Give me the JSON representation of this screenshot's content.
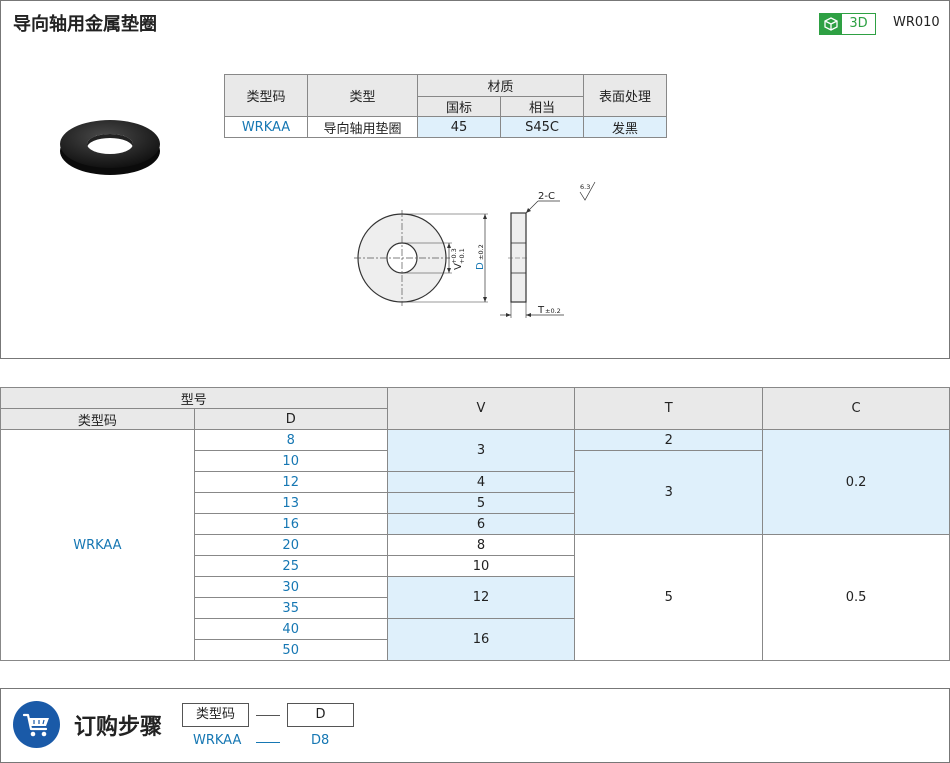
{
  "header": {
    "title": "导向轴用金属垫圈",
    "badge_3d": "3D",
    "product_code": "WR010"
  },
  "material_table": {
    "col_type_code": "类型码",
    "col_type": "类型",
    "col_material": "材质",
    "sub_gb": "国标",
    "sub_equiv": "相当",
    "col_surface": "表面处理",
    "row": {
      "type_code": "WRKAA",
      "type": "导向轴用垫圈",
      "gb": "45",
      "equiv": "S45C",
      "surface": "发黑"
    }
  },
  "drawing": {
    "chamfer": "2-C",
    "roughness": "6.3",
    "v_label": "V",
    "v_tol_upper": "+0.3",
    "v_tol_lower": "+0.1",
    "d_label": "D",
    "d_tol": "±0.2",
    "t_label": "T",
    "t_tol": "±0.2"
  },
  "spec_table": {
    "hdr_model": "型号",
    "hdr_type_code": "类型码",
    "hdr_d": "D",
    "hdr_v": "V",
    "hdr_t": "T",
    "hdr_c": "C",
    "type_code": "WRKAA",
    "d_values": [
      "8",
      "10",
      "12",
      "13",
      "16",
      "20",
      "25",
      "30",
      "35",
      "40",
      "50"
    ],
    "v_values": [
      "3",
      "4",
      "5",
      "6",
      "8",
      "10",
      "12",
      "16"
    ],
    "t_values": [
      "2",
      "3",
      "5"
    ],
    "c_values": [
      "0.2",
      "0.5"
    ]
  },
  "order": {
    "title": "订购步骤",
    "box_type_code": "类型码",
    "box_d": "D",
    "example_type_code": "WRKAA",
    "example_d": "D8"
  },
  "colors": {
    "link_blue": "#1677b3",
    "cell_blue": "#dff0fb",
    "header_gray": "#e9e9e9",
    "badge_green": "#2ea043",
    "cart_blue": "#1a5aa8"
  }
}
